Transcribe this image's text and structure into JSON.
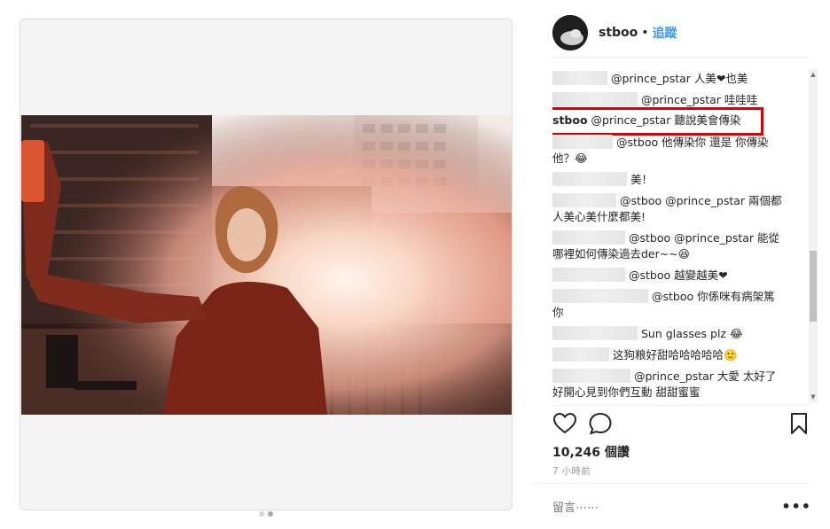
{
  "post": {
    "username": "stboo",
    "bullet": "•",
    "follow_label": "追蹤",
    "views": "10,246 個讚",
    "time_ago": "7 小時前",
    "comment_placeholder": "留言⋯⋯",
    "more_label": "•••"
  },
  "comments": [
    {
      "text": "@prince_pstar 人美❤也美"
    },
    {
      "text": "@prince_pstar 哇哇哇"
    },
    {
      "user": "stboo",
      "text": " @prince_pstar 聽說美會傳染"
    },
    {
      "text": "@stboo 他傳染你 還是 你傳染"
    },
    {
      "text": "他？😂"
    },
    {
      "text": "美！"
    },
    {
      "text": "@stboo @prince_pstar 兩個都"
    },
    {
      "text": "人美心美什麼都美!"
    },
    {
      "text": "@stboo @prince_pstar 能從"
    },
    {
      "text": "哪裡如何傳染過去der~~😆"
    },
    {
      "text": "@stboo 越變越美❤"
    },
    {
      "text": "@stboo 你係咪有病架篤"
    },
    {
      "text": "你"
    },
    {
      "text": "Sun glasses plz 😂"
    },
    {
      "text": "这狗粮好甜哈哈哈哈哈🙂"
    },
    {
      "text": "@prince_pstar 大愛 太好了"
    },
    {
      "text": "好開心見到你們互動 甜甜蜜蜜"
    }
  ]
}
